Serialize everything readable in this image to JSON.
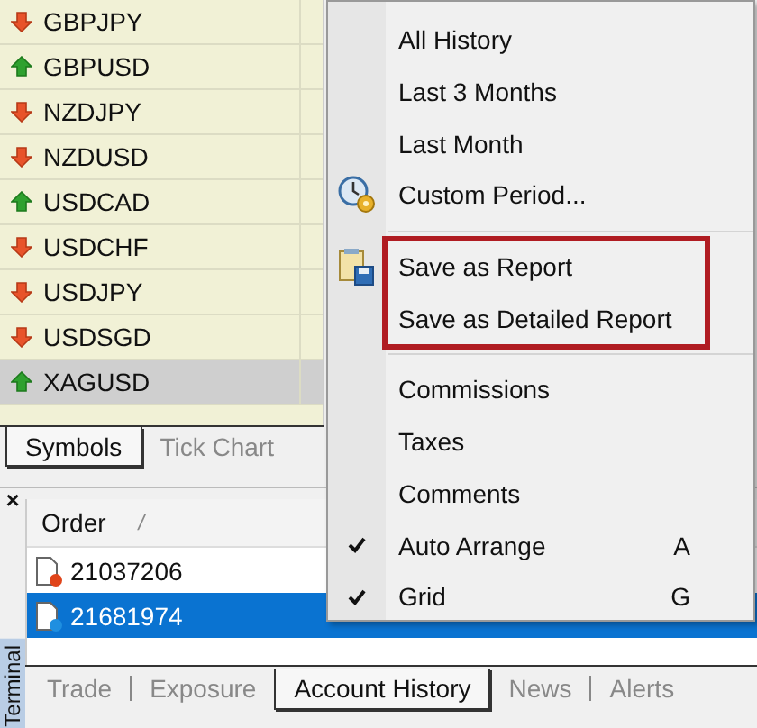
{
  "symbols": [
    {
      "name": "GBPJPY",
      "kind": "down",
      "selected": false
    },
    {
      "name": "GBPUSD",
      "kind": "up",
      "selected": false
    },
    {
      "name": "NZDJPY",
      "kind": "down",
      "selected": false
    },
    {
      "name": "NZDUSD",
      "kind": "down",
      "selected": false
    },
    {
      "name": "USDCAD",
      "kind": "up",
      "selected": false
    },
    {
      "name": "USDCHF",
      "kind": "down",
      "selected": false
    },
    {
      "name": "USDJPY",
      "kind": "down",
      "selected": false
    },
    {
      "name": "USDSGD",
      "kind": "down",
      "selected": false
    },
    {
      "name": "XAGUSD",
      "kind": "up",
      "selected": true
    }
  ],
  "watch_tabs": [
    {
      "label": "Symbols",
      "selected": true
    },
    {
      "label": "Tick Chart",
      "selected": false
    }
  ],
  "terminal": {
    "title": "Terminal",
    "close": "×",
    "columns": [
      "Order",
      "/"
    ],
    "rows": [
      {
        "order": "21037206",
        "kind": "closed",
        "selected": false
      },
      {
        "order": "21681974",
        "kind": "open",
        "selected": true
      }
    ],
    "tabs": [
      {
        "label": "Trade",
        "selected": false
      },
      {
        "label": "Exposure",
        "selected": false
      },
      {
        "label": "Account History",
        "selected": true
      },
      {
        "label": "News",
        "selected": false
      },
      {
        "label": "Alerts",
        "selected": false
      }
    ]
  },
  "context_menu": {
    "sections": [
      {
        "highlighted": false,
        "items": [
          {
            "label": "All History",
            "kind": "plain",
            "checked": false
          },
          {
            "label": "Last 3 Months",
            "kind": "plain",
            "checked": false
          },
          {
            "label": "Last Month",
            "kind": "plain",
            "checked": false
          },
          {
            "label": "Custom Period...",
            "kind": "clock",
            "checked": false
          }
        ]
      },
      {
        "highlighted": true,
        "items": [
          {
            "label": "Save as Report",
            "kind": "save",
            "checked": false
          },
          {
            "label": "Save as Detailed Report",
            "kind": "plain",
            "checked": false
          }
        ]
      },
      {
        "highlighted": false,
        "items": [
          {
            "label": "Commissions",
            "kind": "plain",
            "checked": false
          },
          {
            "label": "Taxes",
            "kind": "plain",
            "checked": false
          },
          {
            "label": "Comments",
            "kind": "plain",
            "checked": false
          },
          {
            "label": "Auto Arrange",
            "kind": "plain",
            "checked": true,
            "shortcut": "A"
          },
          {
            "label": "Grid",
            "kind": "plain",
            "checked": true,
            "shortcut": "G"
          }
        ]
      }
    ]
  }
}
